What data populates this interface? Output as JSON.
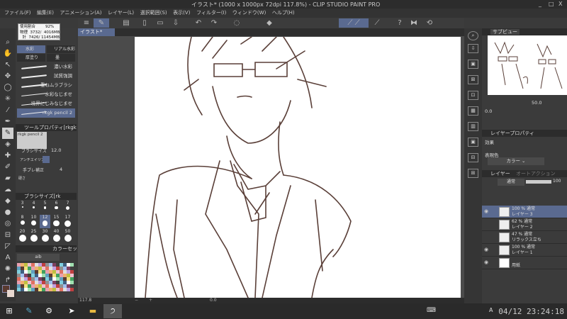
{
  "window": {
    "title": "イラスト* (1000 x 1000px 72dpi 117.8%) - CLIP STUDIO PAINT PRO",
    "minimize": "_",
    "maximize": "□",
    "close": "X"
  },
  "menu": [
    "ファイル(F)",
    "編集(E)",
    "アニメーション(A)",
    "レイヤー(L)",
    "選択範囲(S)",
    "表示(V)",
    "フィルター(I)",
    "ウィンドウ(W)",
    "ヘルプ(H)"
  ],
  "memory_tooltip": {
    "line1": "使用割合        92%",
    "line2": "物理  3732/  4016MB",
    "line3": "  計  7426/ 11454MB"
  },
  "document_tab": {
    "label": "イラスト*",
    "close": "×"
  },
  "brush_panel": {
    "tabs": [
      "水彩",
      "リアル水彩",
      "厚塗り",
      "墨"
    ],
    "brushes": [
      "濃い水彩",
      "試質強調",
      "重ねムラブラシ",
      "水彩なじませ",
      "境界にじみなじませ",
      "rkgk pencil 2"
    ],
    "selected": "rkgk pencil 2"
  },
  "tool_property": {
    "title": "ツールプロパティ[rkgk",
    "preview_label": "rkgk pencil 2",
    "brush_size_label": "ブラシサイズ",
    "brush_size": "12.0",
    "antialias_label": "アンチエイリアス",
    "stabilization_label": "手ブレ補正",
    "stabilization": "4",
    "hardness_label": "硬さ"
  },
  "brush_size_panel": {
    "title": "ブラシサイズ[rk",
    "sizes": [
      "3",
      "4",
      "5",
      "6",
      "7",
      "8",
      "10",
      "12",
      "15",
      "17",
      "20",
      "25",
      "30",
      "40",
      "50"
    ],
    "selected": "12"
  },
  "color_set_panel": {
    "title": "カラーセット",
    "set_name": "aib"
  },
  "colors": {
    "main": "#5a3a30",
    "sub": "#e8d8d0",
    "accent": "#5a6a90",
    "line": "#5a3f38"
  },
  "status": {
    "zoom": "117.8",
    "angle": "0.0"
  },
  "navigator": {
    "title": "サブビュー",
    "zoom": "50.0",
    "rotation": "0.0"
  },
  "layer_property": {
    "title": "レイヤープロパティ",
    "effect_label": "効果",
    "expression_label": "表現色",
    "expression_value": "カラー"
  },
  "layer_panel": {
    "tab": "レイヤー",
    "tab2": "オートアクション",
    "blend_mode": "通常",
    "opacity": "100",
    "layers": [
      {
        "info": "100 % 通常",
        "name": "レイヤー 3",
        "visible": true,
        "selected": true
      },
      {
        "info": "62 % 通常",
        "name": "レイヤー 2",
        "visible": false
      },
      {
        "info": "47 % 通常",
        "name": "リラックス立ち",
        "visible": false
      },
      {
        "info": "100 % 通常",
        "name": "レイヤー 1",
        "visible": true
      },
      {
        "info": "",
        "name": "用紙",
        "visible": true
      }
    ]
  },
  "taskbar": {
    "clock": "04/12 23:24:18",
    "ime": "A"
  }
}
